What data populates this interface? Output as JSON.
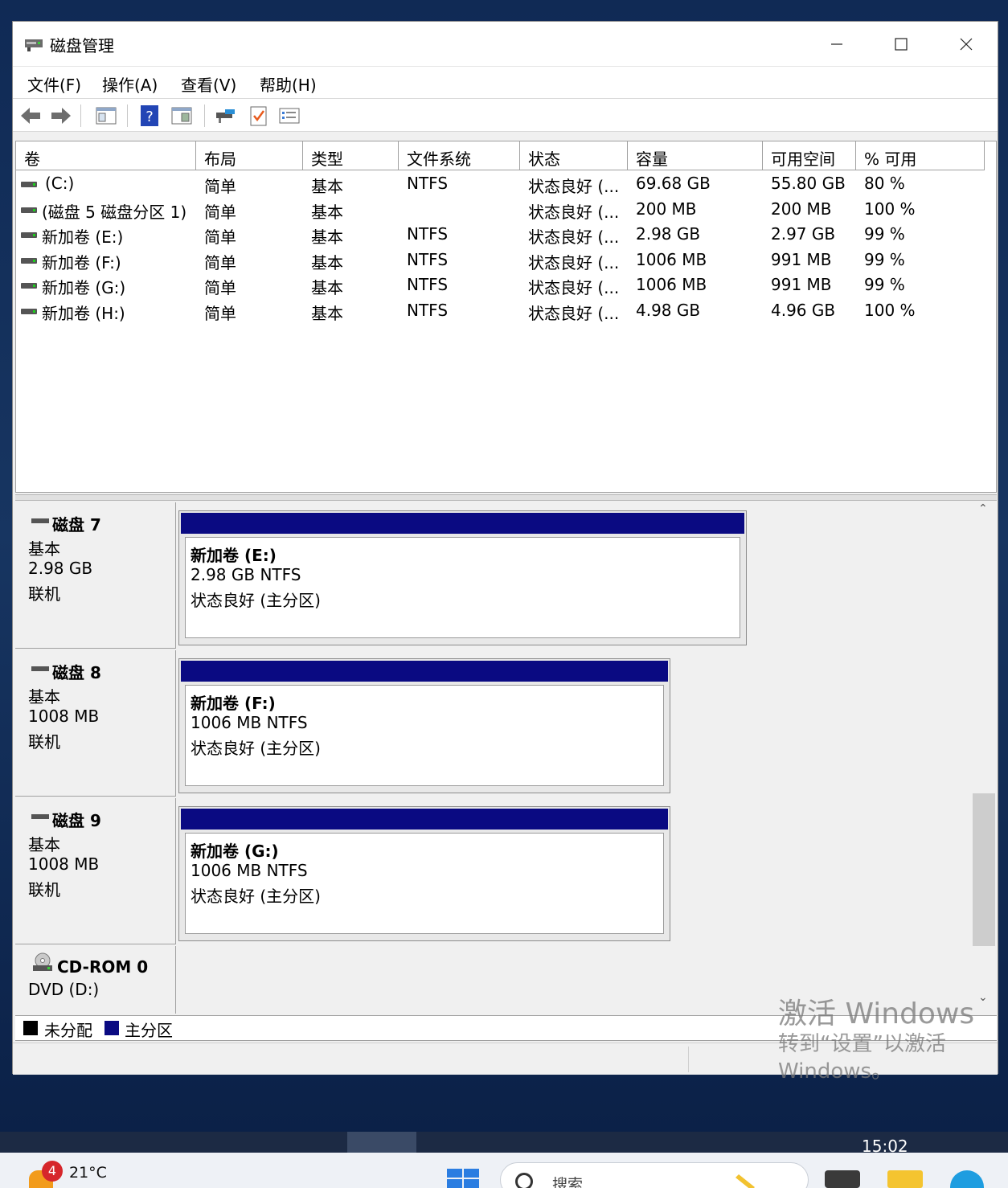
{
  "window": {
    "title": "磁盘管理",
    "controls": {
      "minimize": "−",
      "maximize": "☐",
      "close": "✕"
    }
  },
  "menu": [
    "文件(F)",
    "操作(A)",
    "查看(V)",
    "帮助(H)"
  ],
  "toolbar_icons": [
    "back-icon",
    "forward-icon",
    "properties-icon",
    "help-icon",
    "view-icon",
    "connect-icon",
    "check-icon",
    "list-icon"
  ],
  "columns": [
    "卷",
    "布局",
    "类型",
    "文件系统",
    "状态",
    "容量",
    "可用空间",
    "% 可用"
  ],
  "volumes": [
    {
      "name": "(C:)",
      "layout": "简单",
      "type": "基本",
      "fs": "NTFS",
      "status": "状态良好 (...",
      "capacity": "69.68 GB",
      "free": "55.80 GB",
      "pct": "80 %"
    },
    {
      "name": "(磁盘 5 磁盘分区 1)",
      "layout": "简单",
      "type": "基本",
      "fs": "",
      "status": "状态良好 (...",
      "capacity": "200 MB",
      "free": "200 MB",
      "pct": "100 %"
    },
    {
      "name": "新加卷 (E:)",
      "layout": "简单",
      "type": "基本",
      "fs": "NTFS",
      "status": "状态良好 (...",
      "capacity": "2.98 GB",
      "free": "2.97 GB",
      "pct": "99 %"
    },
    {
      "name": "新加卷 (F:)",
      "layout": "简单",
      "type": "基本",
      "fs": "NTFS",
      "status": "状态良好 (...",
      "capacity": "1006 MB",
      "free": "991 MB",
      "pct": "99 %"
    },
    {
      "name": "新加卷 (G:)",
      "layout": "简单",
      "type": "基本",
      "fs": "NTFS",
      "status": "状态良好 (...",
      "capacity": "1006 MB",
      "free": "991 MB",
      "pct": "99 %"
    },
    {
      "name": "新加卷 (H:)",
      "layout": "简单",
      "type": "基本",
      "fs": "NTFS",
      "status": "状态良好 (...",
      "capacity": "4.98 GB",
      "free": "4.96 GB",
      "pct": "100 %"
    }
  ],
  "disks": [
    {
      "name": "磁盘 7",
      "type": "基本",
      "size": "2.98 GB",
      "state": "联机",
      "partition": {
        "name": "新加卷  (E:)",
        "size_fs": "2.98 GB NTFS",
        "status": "状态良好 (主分区)"
      }
    },
    {
      "name": "磁盘 8",
      "type": "基本",
      "size": "1008 MB",
      "state": "联机",
      "partition": {
        "name": "新加卷  (F:)",
        "size_fs": "1006 MB NTFS",
        "status": "状态良好 (主分区)"
      }
    },
    {
      "name": "磁盘 9",
      "type": "基本",
      "size": "1008 MB",
      "state": "联机",
      "partition": {
        "name": "新加卷  (G:)",
        "size_fs": "1006 MB NTFS",
        "status": "状态良好 (主分区)"
      }
    }
  ],
  "cdrom": {
    "name": "CD-ROM 0",
    "drive": "DVD (D:)"
  },
  "legend": [
    {
      "label": "未分配",
      "color": "#000000"
    },
    {
      "label": "主分区",
      "color": "#0a0a82"
    }
  ],
  "watermark": {
    "line1": "激活 Windows",
    "line2": "转到“设置”以激活",
    "line3": "Windows。"
  },
  "taskbar": {
    "clock": "15:02",
    "weather_badge": "4",
    "temperature": "21°C",
    "search_placeholder": "搜索"
  }
}
